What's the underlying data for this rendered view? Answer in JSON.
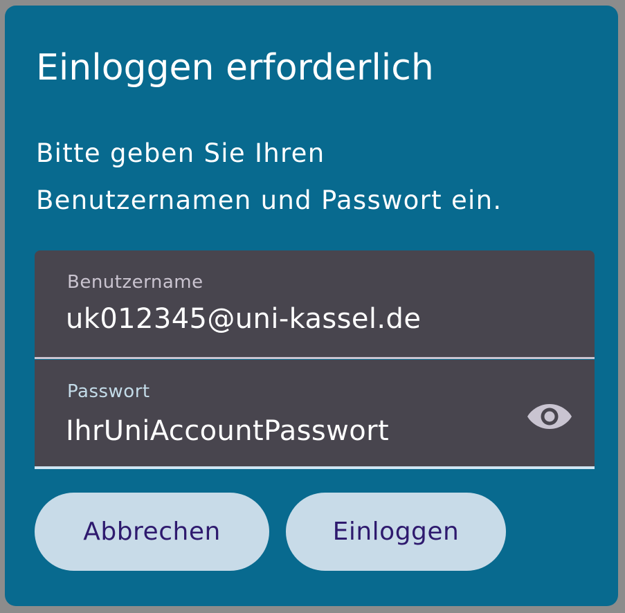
{
  "dialog": {
    "title": "Einloggen erforderlich",
    "message_line1": "Bitte geben Sie Ihren",
    "message_line2": "Benutzernamen und Passwort ein."
  },
  "username": {
    "label": "Benutzername",
    "value": "uk012345@uni-kassel.de"
  },
  "password": {
    "label": "Passwort",
    "value": "IhrUniAccountPasswort",
    "visibility_icon": "eye-icon"
  },
  "buttons": {
    "cancel_label": "Abbrechen",
    "login_label": "Einloggen"
  },
  "colors": {
    "dialog_background": "#086a8f",
    "field_background": "#48454e",
    "button_background": "#c8dbe8",
    "button_text": "#2e1a6e",
    "active_indicator": "#cfe5f3"
  }
}
